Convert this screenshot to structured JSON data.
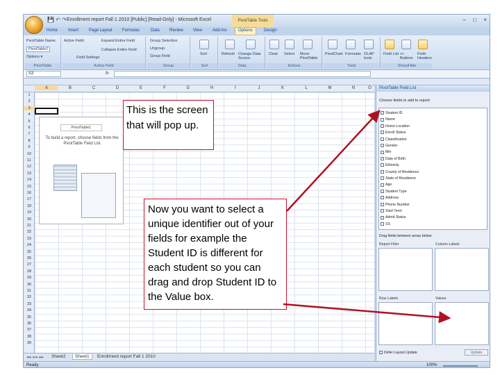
{
  "window": {
    "title": "Enrollment report Fall 1 2010 [Public] [Read-Only] - Microsoft Excel",
    "contextual_tab": "PivotTable Tools",
    "controls": [
      "–",
      "□",
      "×"
    ]
  },
  "ribbon_tabs": [
    {
      "label": "Home"
    },
    {
      "label": "Insert"
    },
    {
      "label": "Page Layout"
    },
    {
      "label": "Formulas"
    },
    {
      "label": "Data"
    },
    {
      "label": "Review"
    },
    {
      "label": "View"
    },
    {
      "label": "Add-Ins"
    },
    {
      "label": "Options"
    },
    {
      "label": "Design"
    }
  ],
  "ribbon_groups": [
    {
      "title": "PivotTable",
      "items": [
        "PivotTable Name:",
        "PivotTable1",
        "Options ▾"
      ]
    },
    {
      "title": "Active Field",
      "items": [
        "Active Field:",
        "Expand Entire Field",
        "Collapse Entire Field",
        "Field Settings"
      ]
    },
    {
      "title": "Group",
      "items": [
        "Group Selection",
        "Ungroup",
        "Group Field"
      ]
    },
    {
      "title": "Sort",
      "items": [
        "Sort"
      ]
    },
    {
      "title": "Data",
      "items": [
        "Refresh",
        "Change Data Source"
      ]
    },
    {
      "title": "Actions",
      "items": [
        "Clear",
        "Select",
        "Move PivotTable"
      ]
    },
    {
      "title": "Tools",
      "items": [
        "PivotChart",
        "Formulas",
        "OLAP tools"
      ]
    },
    {
      "title": "Show/Hide",
      "items": [
        "Field List",
        "+/- Buttons",
        "Field Headers"
      ]
    }
  ],
  "formula_bar": {
    "name_box": "A3",
    "fx": "fx",
    "formula": ""
  },
  "columns": [
    "A",
    "B",
    "C",
    "D",
    "E",
    "F",
    "G",
    "H",
    "I",
    "J",
    "K",
    "L",
    "M",
    "N",
    "O"
  ],
  "rows": [
    "1",
    "2",
    "3",
    "4",
    "5",
    "6",
    "7",
    "8",
    "9",
    "10",
    "11",
    "12",
    "13",
    "14",
    "15",
    "16",
    "17",
    "18",
    "19",
    "20",
    "21",
    "22",
    "23",
    "24",
    "25",
    "26",
    "27",
    "28",
    "29",
    "30",
    "31",
    "32",
    "33",
    "34",
    "35",
    "36",
    "37",
    "38",
    "39"
  ],
  "pivot_placeholder": {
    "name": "PivotTable1",
    "hint": "To build a report, choose fields from the PivotTable Field List"
  },
  "sheet_tabs": [
    {
      "label": "Sheet2"
    },
    {
      "label": "Sheet1"
    },
    {
      "label": "Enrollment report Fall 1 2010"
    }
  ],
  "status_bar": {
    "left": "Ready",
    "zoom": "100%"
  },
  "field_list": {
    "title": "PivotTable Field List",
    "choose_label": "Choose fields to add to report:",
    "fields": [
      "Student ID",
      "Name",
      "Home Location",
      "Enroll Status",
      "Classification",
      "Gender",
      "Min",
      "Date of Birth",
      "Ethnicity",
      "County of Residence",
      "State of Residence",
      "Age",
      "Student Type",
      "Address",
      "Phone Number",
      "Start Term",
      "Admit Status",
      "SS"
    ],
    "drag_label": "Drag fields between areas below:",
    "areas": [
      "Report Filter",
      "Column Labels",
      "Row Labels",
      "Values"
    ],
    "defer_label": "Defer Layout Update",
    "update_label": "Update"
  },
  "callouts": {
    "screen_note": "This is the screen that will pop up.",
    "instruction": "Now you want to select a unique identifier out of your fields for example the Student ID is different for each student so you can drag and drop Student ID to the Value box."
  },
  "colors": {
    "callout_border": "#c8102e",
    "arrow": "#b01020",
    "ribbon": "#cbdcf0",
    "contextual_tab": "#f4dd9a"
  }
}
